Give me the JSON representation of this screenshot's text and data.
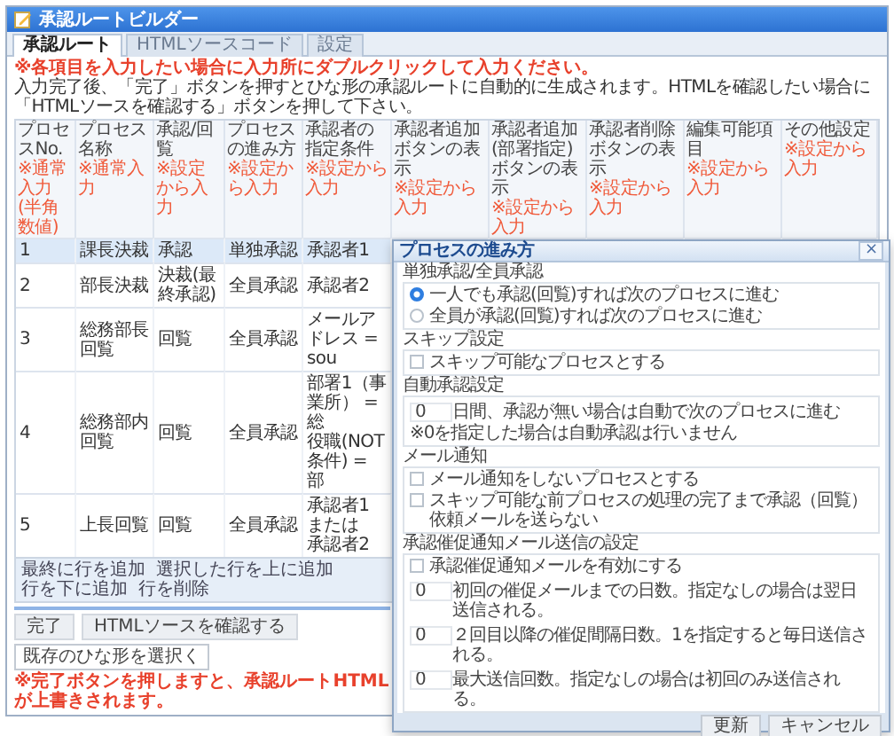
{
  "window": {
    "title": "承認ルートビルダー"
  },
  "tabs": [
    {
      "label": "承認ルート",
      "selected": true
    },
    {
      "label": "HTMLソースコード",
      "selected": false
    },
    {
      "label": "設定",
      "selected": false
    }
  ],
  "notice": "※各項目を入力したい場合に入力所にダブルクリックして入力ください。",
  "instructions": "入力完了後、「完了」ボタンを押すとひな形の承認ルートに自動的に生成されます。HTMLを確認したい場合に「HTMLソースを確認する」ボタンを押して下さい。",
  "table": {
    "columns": [
      {
        "label": "プロセスNo.",
        "note": "※通常入力 (半角数値)"
      },
      {
        "label": "プロセス名称",
        "note": "※通常入力"
      },
      {
        "label": "承認/回覧",
        "note": "※設定から入力"
      },
      {
        "label": "プロセスの進み方",
        "note": "※設定から入力"
      },
      {
        "label": "承認者の指定条件",
        "note": "※設定から入力"
      },
      {
        "label": "承認者追加ボタンの表示",
        "note": "※設定から入力"
      },
      {
        "label": "承認者追加(部署指定)ボタンの表示",
        "note": "※設定から入力"
      },
      {
        "label": "承認者削除ボタンの表示",
        "note": "※設定から入力"
      },
      {
        "label": "編集可能項目",
        "note": "※設定から入力"
      },
      {
        "label": "その他設定",
        "note": "※設定から入力"
      }
    ],
    "rows": [
      {
        "selected": true,
        "cells": [
          "1",
          "課長決裁",
          "承認",
          "単独承認",
          "承認者1"
        ]
      },
      {
        "selected": false,
        "cells": [
          "2",
          "部長決裁",
          "決裁(最終承認)",
          "全員承認",
          "承認者2"
        ]
      },
      {
        "selected": false,
        "cells": [
          "3",
          "総務部長回覧",
          "回覧",
          "全員承認",
          "メールアドレス = sou"
        ]
      },
      {
        "selected": false,
        "cells": [
          "4",
          "総務部内回覧",
          "回覧",
          "全員承認",
          [
            "部署1（事業所） = 総",
            "役職(NOT条件) = 部"
          ]
        ]
      },
      {
        "selected": false,
        "cells": [
          "5",
          "上長回覧",
          "回覧",
          "全員承認",
          [
            "承認者1 または",
            "承認者2"
          ]
        ]
      }
    ]
  },
  "row_actions": [
    "最終に行を追加",
    "選択した行を上に追加",
    "行を下に追加",
    "行を削除"
  ],
  "buttons": [
    "完了",
    "HTMLソースを確認する"
  ],
  "template_select": {
    "value": "既存のひな形を選択く"
  },
  "warning": "※完了ボタンを押しますと、承認ルートHTMLが上書きされます。",
  "dialog": {
    "title": "プロセスの進み方",
    "close": "×",
    "sections": [
      {
        "label": "単独承認/全員承認",
        "items": [
          {
            "kind": "radio",
            "label": "一人でも承認(回覧)すれば次のプロセスに進む",
            "selected": true
          },
          {
            "kind": "radio",
            "label": "全員が承認(回覧)すれば次のプロセスに進む",
            "selected": false
          }
        ]
      },
      {
        "label": "スキップ設定",
        "items": [
          {
            "kind": "checkbox",
            "label": "スキップ可能なプロセスとする",
            "checked": false
          }
        ]
      },
      {
        "label": "自動承認設定",
        "items": [
          {
            "kind": "number",
            "value": "0",
            "description": "日間、承認が無い場合は自動で次のプロセスに進む"
          },
          {
            "kind": "note",
            "text": "※0を指定した場合は自動承認は行いません"
          }
        ]
      },
      {
        "label": "メール通知",
        "items": [
          {
            "kind": "checkbox",
            "label": "メール通知をしないプロセスとする",
            "checked": false
          },
          {
            "kind": "checkbox",
            "label": "スキップ可能な前プロセスの処理の完了まで承認（回覧）依頼メールを送らない",
            "checked": false
          }
        ]
      },
      {
        "label": "承認催促通知メール送信の設定",
        "items": [
          {
            "kind": "checkbox",
            "label": "承認催促通知メールを有効にする",
            "checked": false
          },
          {
            "kind": "number",
            "value": "0",
            "description": "初回の催促メールまでの日数。指定なしの場合は翌日送信される。"
          },
          {
            "kind": "number",
            "value": "0",
            "description": "２回目以降の催促間隔日数。1を指定すると毎日送信される。"
          },
          {
            "kind": "number",
            "value": "0",
            "description": "最大送信回数。指定なしの場合は初回のみ送信される。"
          }
        ]
      }
    ],
    "buttons": [
      "更新",
      "キャンセル"
    ]
  }
}
